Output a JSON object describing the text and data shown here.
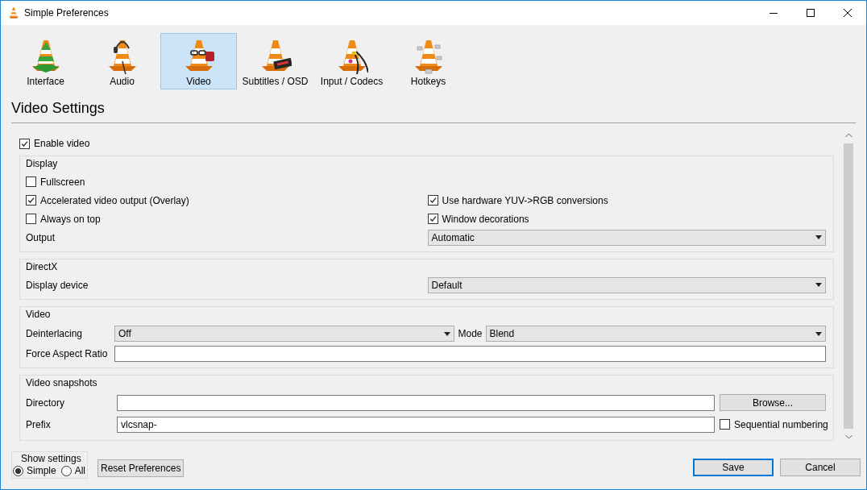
{
  "window": {
    "title": "Simple Preferences"
  },
  "categories": [
    {
      "label": "Interface",
      "selected": false
    },
    {
      "label": "Audio",
      "selected": false
    },
    {
      "label": "Video",
      "selected": true
    },
    {
      "label": "Subtitles / OSD",
      "selected": false
    },
    {
      "label": "Input / Codecs",
      "selected": false
    },
    {
      "label": "Hotkeys",
      "selected": false
    }
  ],
  "heading": "Video Settings",
  "enable_video": {
    "label": "Enable video",
    "checked": true
  },
  "groups": [
    {
      "title": "Display",
      "rows": [
        {
          "kind": "checks",
          "items": [
            {
              "label": "Fullscreen",
              "checked": false
            }
          ]
        },
        {
          "kind": "checks",
          "items": [
            {
              "label": "Accelerated video output (Overlay)",
              "checked": true
            },
            {
              "label": "Use hardware YUV->RGB conversions",
              "checked": true
            }
          ]
        },
        {
          "kind": "checks",
          "items": [
            {
              "label": "Always on top",
              "checked": false
            },
            {
              "label": "Window decorations",
              "checked": true
            }
          ]
        },
        {
          "kind": "combo",
          "label": "Output",
          "value": "Automatic"
        }
      ]
    },
    {
      "title": "DirectX",
      "rows": [
        {
          "kind": "combo",
          "label": "Display device",
          "value": "Default"
        }
      ]
    },
    {
      "title": "Video",
      "rows": [
        {
          "kind": "combo_pair",
          "label": "Deinterlacing",
          "value": "Off",
          "label2": "Mode",
          "value2": "Blend"
        },
        {
          "kind": "field",
          "label": "Force Aspect Ratio"
        }
      ]
    },
    {
      "title": "Video snapshots",
      "rows": [
        {
          "kind": "browse",
          "label": "Directory",
          "button": "Browse..."
        },
        {
          "kind": "field_check",
          "label": "Prefix",
          "value": "vlcsnap-",
          "check": {
            "label": "Sequential numbering",
            "checked": false
          }
        }
      ]
    }
  ],
  "show_settings": {
    "title": "Show settings",
    "options": [
      {
        "label": "Simple",
        "selected": true
      },
      {
        "label": "All",
        "selected": false
      }
    ]
  },
  "reset_button": "Reset Preferences",
  "actions": [
    {
      "label": "Save",
      "default": true
    },
    {
      "label": "Cancel",
      "default": false
    }
  ]
}
